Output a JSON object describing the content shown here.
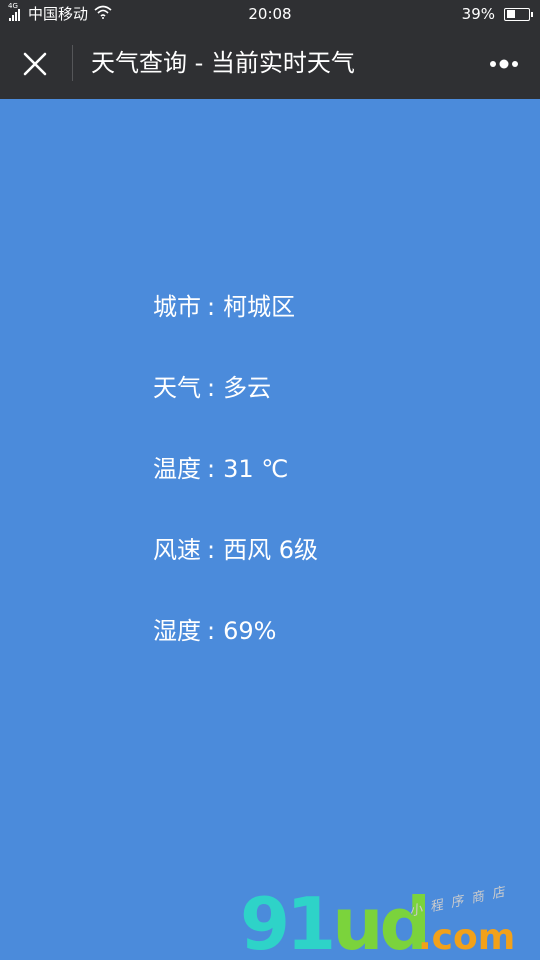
{
  "status_bar": {
    "network": "4G",
    "carrier": "中国移动",
    "time": "20:08",
    "battery": "39%",
    "battery_level": 0.39,
    "icons": [
      "signal-icon",
      "wifi-icon",
      "battery-icon"
    ]
  },
  "nav": {
    "title": "天气查询 - 当前实时天气",
    "close_icon": "close-icon",
    "more_icon": "more-icon"
  },
  "weather": {
    "rows": [
      {
        "label": "城市",
        "sep": ":",
        "value": "柯城区"
      },
      {
        "label": "天气",
        "sep": ":",
        "value": "多云"
      },
      {
        "label": "温度",
        "sep": ":",
        "value": "31 ℃"
      },
      {
        "label": "风速",
        "sep": ":",
        "value": "西风 6级"
      },
      {
        "label": "湿度",
        "sep": ":",
        "value": "69%"
      }
    ]
  },
  "watermark": {
    "main_a": "91",
    "main_b": "ud",
    "domain": ".com",
    "small_text": "小程序商店"
  },
  "colors": {
    "background": "#4b8bdb",
    "bar": "#2f3033",
    "text": "#ffffff"
  }
}
